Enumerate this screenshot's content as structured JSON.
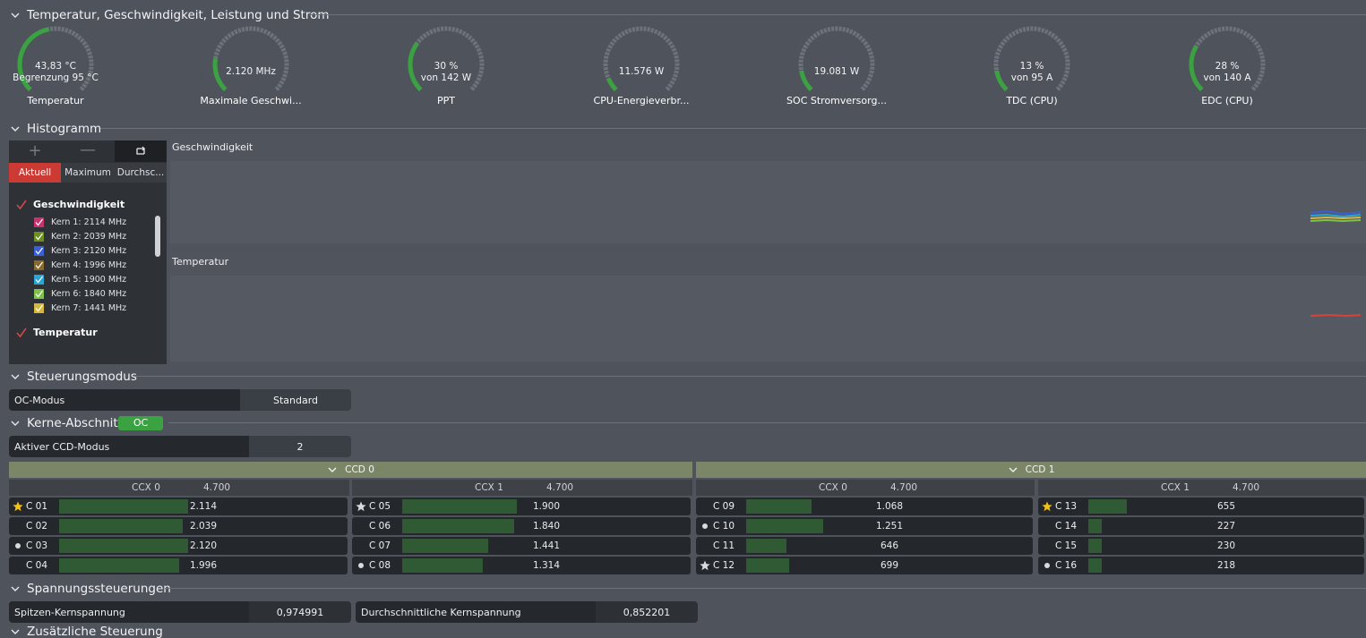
{
  "sections": {
    "temp": "Temperatur, Geschwindigkeit, Leistung und Strom",
    "hist": "Histogramm",
    "ctrl": "Steuerungsmodus",
    "cores": "Kerne-Abschnitt",
    "volt": "Spannungssteuerungen",
    "extra": "Zusätzliche Steuerung"
  },
  "gauges": [
    {
      "line1": "43,83 °C",
      "line2": "Begrenzung 95 °C",
      "label": "Temperatur",
      "fraction": 0.46
    },
    {
      "line1": "2.120  MHz",
      "line2": "",
      "label": "Maximale Geschwi...",
      "fraction": 0.2
    },
    {
      "line1": "30 %",
      "line2": "von 142 W",
      "label": "PPT",
      "fraction": 0.3
    },
    {
      "line1": "11.576 W",
      "line2": "",
      "label": "CPU-Energieverbr...",
      "fraction": 0.08
    },
    {
      "line1": "19.081 W",
      "line2": "",
      "label": "SOC Stromversorg...",
      "fraction": 0.13
    },
    {
      "line1": "13 %",
      "line2": "von 95 A",
      "label": "TDC (CPU)",
      "fraction": 0.13
    },
    {
      "line1": "28 %",
      "line2": "von 140 A",
      "label": "EDC (CPU)",
      "fraction": 0.28
    }
  ],
  "histogram": {
    "tabs": [
      "Aktuell",
      "Maximum",
      "Durchsc..."
    ],
    "group1": "Geschwindigkeit",
    "group2": "Temperatur",
    "cores": [
      {
        "label": "Kern 1: 2114 MHz",
        "color": "#c8326e"
      },
      {
        "label": "Kern 2: 2039 MHz",
        "color": "#6d8f1d"
      },
      {
        "label": "Kern 3: 2120 MHz",
        "color": "#3a5fd6"
      },
      {
        "label": "Kern 4: 1996 MHz",
        "color": "#8a6a2a"
      },
      {
        "label": "Kern 5: 1900 MHz",
        "color": "#2aa6d6"
      },
      {
        "label": "Kern 6: 1840 MHz",
        "color": "#7dc24a"
      },
      {
        "label": "Kern 7: 1441 MHz",
        "color": "#d8b83a"
      }
    ],
    "chart1_title": "Geschwindigkeit",
    "chart2_title": "Temperatur"
  },
  "oc_mode": {
    "label": "OC-Modus",
    "value": "Standard"
  },
  "oc_badge": "OC",
  "ccd_mode": {
    "label": "Aktiver CCD-Modus",
    "value": "2"
  },
  "ccd": [
    {
      "title": "CCD 0"
    },
    {
      "title": "CCD 1"
    }
  ],
  "ccx": [
    {
      "name": "CCX 0",
      "max": "4.700"
    },
    {
      "name": "CCX 1",
      "max": "4.700"
    },
    {
      "name": "CCX 0",
      "max": "4.700"
    },
    {
      "name": "CCX 1",
      "max": "4.700"
    }
  ],
  "cores": [
    [
      {
        "name": "C 01",
        "value": "2.114",
        "mark": "star-gold",
        "fraction": 0.45
      },
      {
        "name": "C 02",
        "value": "2.039",
        "mark": "",
        "fraction": 0.43
      },
      {
        "name": "C 03",
        "value": "2.120",
        "mark": "dot",
        "fraction": 0.45
      },
      {
        "name": "C 04",
        "value": "1.996",
        "mark": "",
        "fraction": 0.42
      }
    ],
    [
      {
        "name": "C 05",
        "value": "1.900",
        "mark": "star-white",
        "fraction": 0.4
      },
      {
        "name": "C 06",
        "value": "1.840",
        "mark": "",
        "fraction": 0.39
      },
      {
        "name": "C 07",
        "value": "1.441",
        "mark": "",
        "fraction": 0.3
      },
      {
        "name": "C 08",
        "value": "1.314",
        "mark": "dot",
        "fraction": 0.28
      }
    ],
    [
      {
        "name": "C 09",
        "value": "1.068",
        "mark": "",
        "fraction": 0.23
      },
      {
        "name": "C 10",
        "value": "1.251",
        "mark": "dot",
        "fraction": 0.27
      },
      {
        "name": "C 11",
        "value": "646",
        "mark": "",
        "fraction": 0.14
      },
      {
        "name": "C 12",
        "value": "699",
        "mark": "star-white",
        "fraction": 0.15
      }
    ],
    [
      {
        "name": "C 13",
        "value": "655",
        "mark": "star-gold",
        "fraction": 0.14
      },
      {
        "name": "C 14",
        "value": "227",
        "mark": "",
        "fraction": 0.05
      },
      {
        "name": "C 15",
        "value": "230",
        "mark": "",
        "fraction": 0.05
      },
      {
        "name": "C 16",
        "value": "218",
        "mark": "dot",
        "fraction": 0.05
      }
    ]
  ],
  "voltage": [
    {
      "label": "Spitzen-Kernspannung",
      "value": "0,974991"
    },
    {
      "label": "Durchschnittliche Kernspannung",
      "value": "0,852201"
    }
  ],
  "colors": {
    "accent_green": "#3aa241",
    "active_tab": "#cc3a34",
    "bar_green": "#2f5a33"
  }
}
